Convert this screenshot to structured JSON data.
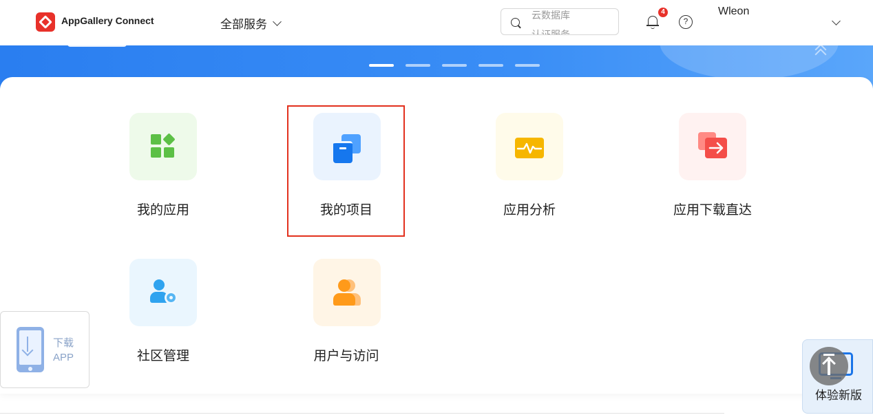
{
  "header": {
    "brand": "AppGallery Connect",
    "services_menu": "全部服务",
    "search": {
      "line1": "云数据库",
      "line2": "认证服务"
    },
    "notifications_count": "4",
    "help_glyph": "?",
    "user_name": "Wleon"
  },
  "banner": {
    "slides": 5,
    "active_slide": 1
  },
  "tiles": [
    {
      "label": "我的应用",
      "icon": "apps-icon",
      "bg": "#eefaea"
    },
    {
      "label": "我的项目",
      "icon": "projects-icon",
      "bg": "#eaf3fe",
      "highlighted": true
    },
    {
      "label": "应用分析",
      "icon": "analytics-icon",
      "bg": "#fffbea"
    },
    {
      "label": "应用下载直达",
      "icon": "download-direct-icon",
      "bg": "#fff2f1"
    },
    {
      "label": "社区管理",
      "icon": "community-icon",
      "bg": "#eaf6fe"
    },
    {
      "label": "用户与访问",
      "icon": "user-access-icon",
      "bg": "#fff5e6"
    }
  ],
  "download_app": {
    "line1": "下载",
    "line2": "APP"
  },
  "new_version": {
    "label": "体验新版"
  },
  "colors": {
    "brand_red": "#e8312a",
    "banner_blue": "#2a7ef0",
    "highlight_border": "#e2301d"
  }
}
